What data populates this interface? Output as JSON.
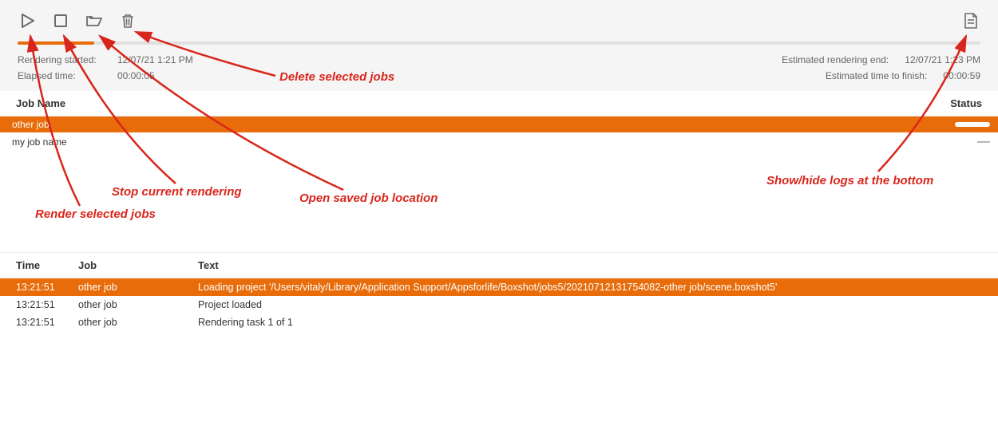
{
  "toolbar": {
    "play_title": "Render selected jobs",
    "stop_title": "Stop current rendering",
    "open_title": "Open saved job location",
    "delete_title": "Delete selected jobs",
    "log_title": "Show/hide logs at the bottom"
  },
  "progress": {
    "percent": 8
  },
  "info": {
    "start_label": "Rendering started:",
    "start_value": "12/07/21 1:21 PM",
    "elapsed_label": "Elapsed time:",
    "elapsed_value": "00:00:05",
    "eta_end_label": "Estimated rendering end:",
    "eta_end_value": "12/07/21 1:23 PM",
    "eta_finish_label": "Estimated time to finish:",
    "eta_finish_value": "00:00:59"
  },
  "job_columns": {
    "name": "Job Name",
    "status": "Status"
  },
  "jobs": [
    {
      "name": "other job",
      "status": "progress"
    },
    {
      "name": "my job name",
      "status": "—"
    }
  ],
  "log_columns": {
    "time": "Time",
    "job": "Job",
    "text": "Text"
  },
  "logs": [
    {
      "time": "13:21:51",
      "job": "other job",
      "text": "Loading project '/Users/vitaly/Library/Application Support/Appsforlife/Boxshot/jobs5/20210712131754082-other job/scene.boxshot5'"
    },
    {
      "time": "13:21:51",
      "job": "other job",
      "text": "Project loaded"
    },
    {
      "time": "13:21:51",
      "job": "other job",
      "text": "Rendering task 1 of 1"
    }
  ],
  "annotations": {
    "play": "Render selected jobs",
    "stop": "Stop current rendering",
    "open": "Open saved job location",
    "delete": "Delete selected jobs",
    "log": "Show/hide logs at the bottom"
  },
  "colors": {
    "accent": "#e86c0a",
    "callout": "#d9261c"
  }
}
